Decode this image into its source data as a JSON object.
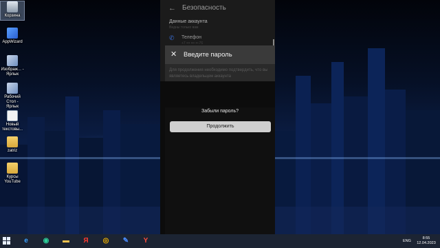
{
  "desktop": {
    "icons": [
      {
        "label": "Корзина",
        "icon": "recycle-bin-icon"
      },
      {
        "label": "AppWizard",
        "icon": "app-icon"
      },
      {
        "label": "Изображ... - Ярлык",
        "icon": "shortcut-icon"
      },
      {
        "label": "Рабочий Стол - Ярлык",
        "icon": "shortcut-icon"
      },
      {
        "label": "Новый текстовы...",
        "icon": "text-file-icon"
      },
      {
        "label": "zatriz",
        "icon": "folder-icon"
      },
      {
        "label": "Курсы YouTube",
        "icon": "folder-icon"
      }
    ]
  },
  "phone": {
    "header": {
      "back_icon": "←",
      "title": "Безопасность"
    },
    "account_section": {
      "title": "Данные аккаунта",
      "subtitle": "Видны только вам"
    },
    "phone_row": {
      "icon": "✆",
      "label": "Телефон",
      "value": "+7 ••• ••• ••-76"
    },
    "dialog": {
      "close_icon": "✕",
      "title": "Введите пароль",
      "description": "Для продолжения необходимо подтвердить, что вы являетесь владельцем аккаунта"
    },
    "bottom": {
      "forgot_label": "Забыли пароль?",
      "continue_label": "Продолжить"
    }
  },
  "taskbar": {
    "apps": [
      {
        "name": "edge-icon",
        "glyph": "e",
        "color": "#3aa0ff"
      },
      {
        "name": "edge-chromium-icon",
        "glyph": "◉",
        "color": "#2ecf9a"
      },
      {
        "name": "file-explorer-icon",
        "glyph": "▬",
        "color": "#f2c14e"
      },
      {
        "name": "yandex-icon",
        "glyph": "Я",
        "color": "#ff3b30"
      },
      {
        "name": "chrome-icon",
        "glyph": "◎",
        "color": "#f4b400"
      },
      {
        "name": "app-wizard-icon",
        "glyph": "✎",
        "color": "#4a8cff"
      },
      {
        "name": "yandex-browser-icon",
        "glyph": "Y",
        "color": "#ff4d3d"
      }
    ],
    "language": "ENG",
    "time": "8:55",
    "date": "12.04.2023"
  }
}
